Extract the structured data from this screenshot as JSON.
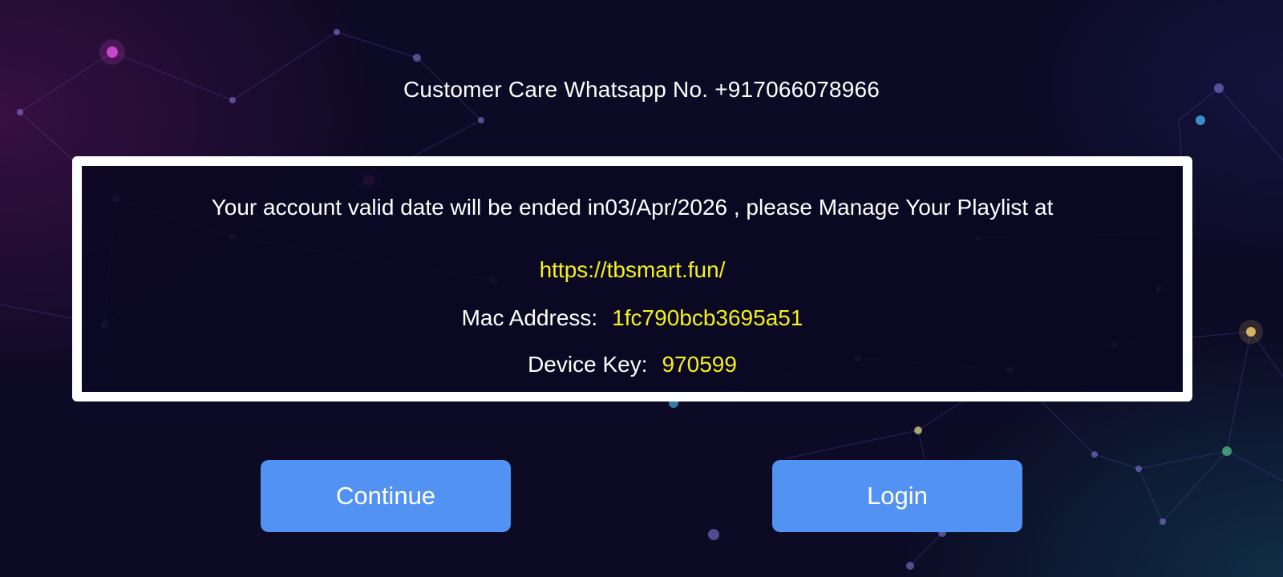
{
  "header": {
    "customer_care": "Customer Care Whatsapp No. +917066078966"
  },
  "info": {
    "validity_message": "Your account valid date will be ended in03/Apr/2026 , please Manage Your Playlist at",
    "url": "https://tbsmart.fun/",
    "mac_label": "Mac Address:",
    "mac_value": "1fc790bcb3695a51",
    "device_key_label": "Device Key:",
    "device_key_value": "970599"
  },
  "buttons": {
    "continue_label": "Continue",
    "login_label": "Login"
  },
  "colors": {
    "background": "#0c0a24",
    "button": "#5292f2",
    "highlight_text": "#f4f01e",
    "border": "#ffffff"
  }
}
